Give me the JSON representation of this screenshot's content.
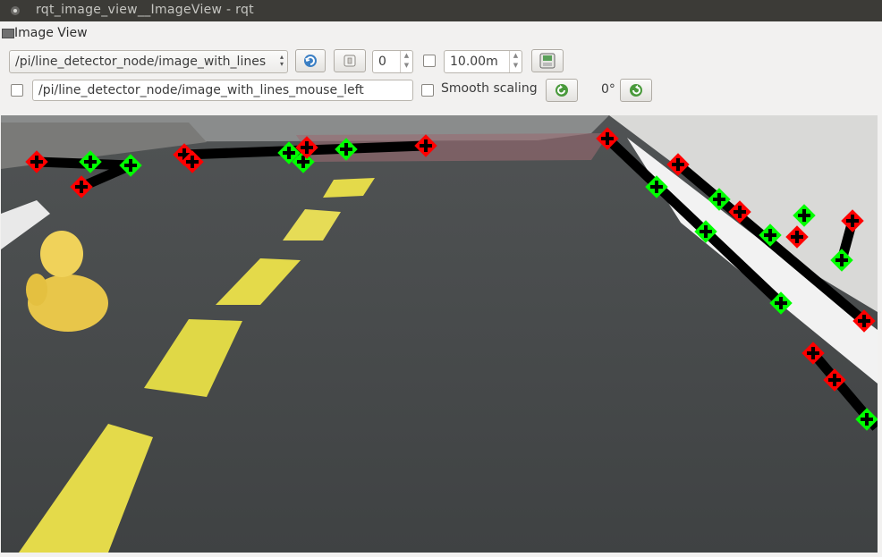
{
  "window": {
    "title": "rqt_image_view__ImageView - rqt"
  },
  "plugin": {
    "title": "Image View"
  },
  "toolbar": {
    "topic": "/pi/line_detector_node/image_with_lines",
    "spin_value": "0",
    "timeout": "10.00m",
    "checkbox1_checked": false
  },
  "row2": {
    "publish_checked": false,
    "mouse_topic": "/pi/line_detector_node/image_with_lines_mouse_left",
    "smooth_scaling_label": "Smooth scaling",
    "smooth_scaling_checked": false,
    "rotation": "0°"
  },
  "image": {
    "description_icons": [
      "refresh-icon",
      "zoom-icon",
      "save-icon",
      "rotate-left-icon",
      "rotate-right-icon"
    ],
    "colors": {
      "road": "#4b4e4f",
      "line_black": "#000000",
      "marker_red": "#ff0000",
      "marker_green": "#00ff00",
      "dash_yellow": "#e0d84a",
      "wall": "#dcdcdc"
    }
  }
}
